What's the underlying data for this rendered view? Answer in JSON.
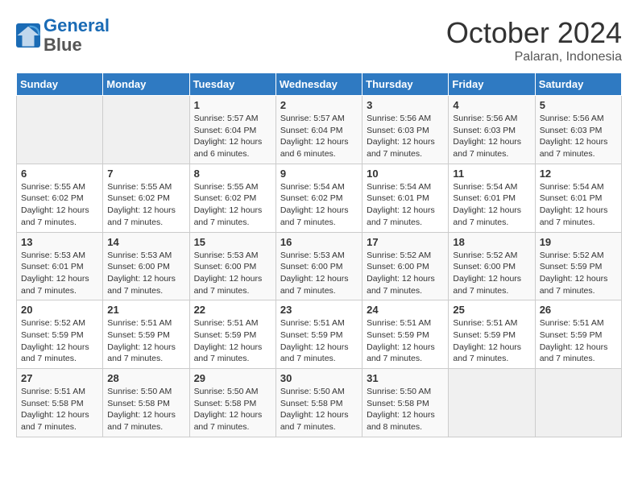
{
  "logo": {
    "line1": "General",
    "line2": "Blue"
  },
  "title": "October 2024",
  "location": "Palaran, Indonesia",
  "days_header": [
    "Sunday",
    "Monday",
    "Tuesday",
    "Wednesday",
    "Thursday",
    "Friday",
    "Saturday"
  ],
  "weeks": [
    [
      {
        "day": "",
        "info": ""
      },
      {
        "day": "",
        "info": ""
      },
      {
        "day": "1",
        "info": "Sunrise: 5:57 AM\nSunset: 6:04 PM\nDaylight: 12 hours\nand 6 minutes."
      },
      {
        "day": "2",
        "info": "Sunrise: 5:57 AM\nSunset: 6:04 PM\nDaylight: 12 hours\nand 6 minutes."
      },
      {
        "day": "3",
        "info": "Sunrise: 5:56 AM\nSunset: 6:03 PM\nDaylight: 12 hours\nand 7 minutes."
      },
      {
        "day": "4",
        "info": "Sunrise: 5:56 AM\nSunset: 6:03 PM\nDaylight: 12 hours\nand 7 minutes."
      },
      {
        "day": "5",
        "info": "Sunrise: 5:56 AM\nSunset: 6:03 PM\nDaylight: 12 hours\nand 7 minutes."
      }
    ],
    [
      {
        "day": "6",
        "info": "Sunrise: 5:55 AM\nSunset: 6:02 PM\nDaylight: 12 hours\nand 7 minutes."
      },
      {
        "day": "7",
        "info": "Sunrise: 5:55 AM\nSunset: 6:02 PM\nDaylight: 12 hours\nand 7 minutes."
      },
      {
        "day": "8",
        "info": "Sunrise: 5:55 AM\nSunset: 6:02 PM\nDaylight: 12 hours\nand 7 minutes."
      },
      {
        "day": "9",
        "info": "Sunrise: 5:54 AM\nSunset: 6:02 PM\nDaylight: 12 hours\nand 7 minutes."
      },
      {
        "day": "10",
        "info": "Sunrise: 5:54 AM\nSunset: 6:01 PM\nDaylight: 12 hours\nand 7 minutes."
      },
      {
        "day": "11",
        "info": "Sunrise: 5:54 AM\nSunset: 6:01 PM\nDaylight: 12 hours\nand 7 minutes."
      },
      {
        "day": "12",
        "info": "Sunrise: 5:54 AM\nSunset: 6:01 PM\nDaylight: 12 hours\nand 7 minutes."
      }
    ],
    [
      {
        "day": "13",
        "info": "Sunrise: 5:53 AM\nSunset: 6:01 PM\nDaylight: 12 hours\nand 7 minutes."
      },
      {
        "day": "14",
        "info": "Sunrise: 5:53 AM\nSunset: 6:00 PM\nDaylight: 12 hours\nand 7 minutes."
      },
      {
        "day": "15",
        "info": "Sunrise: 5:53 AM\nSunset: 6:00 PM\nDaylight: 12 hours\nand 7 minutes."
      },
      {
        "day": "16",
        "info": "Sunrise: 5:53 AM\nSunset: 6:00 PM\nDaylight: 12 hours\nand 7 minutes."
      },
      {
        "day": "17",
        "info": "Sunrise: 5:52 AM\nSunset: 6:00 PM\nDaylight: 12 hours\nand 7 minutes."
      },
      {
        "day": "18",
        "info": "Sunrise: 5:52 AM\nSunset: 6:00 PM\nDaylight: 12 hours\nand 7 minutes."
      },
      {
        "day": "19",
        "info": "Sunrise: 5:52 AM\nSunset: 5:59 PM\nDaylight: 12 hours\nand 7 minutes."
      }
    ],
    [
      {
        "day": "20",
        "info": "Sunrise: 5:52 AM\nSunset: 5:59 PM\nDaylight: 12 hours\nand 7 minutes."
      },
      {
        "day": "21",
        "info": "Sunrise: 5:51 AM\nSunset: 5:59 PM\nDaylight: 12 hours\nand 7 minutes."
      },
      {
        "day": "22",
        "info": "Sunrise: 5:51 AM\nSunset: 5:59 PM\nDaylight: 12 hours\nand 7 minutes."
      },
      {
        "day": "23",
        "info": "Sunrise: 5:51 AM\nSunset: 5:59 PM\nDaylight: 12 hours\nand 7 minutes."
      },
      {
        "day": "24",
        "info": "Sunrise: 5:51 AM\nSunset: 5:59 PM\nDaylight: 12 hours\nand 7 minutes."
      },
      {
        "day": "25",
        "info": "Sunrise: 5:51 AM\nSunset: 5:59 PM\nDaylight: 12 hours\nand 7 minutes."
      },
      {
        "day": "26",
        "info": "Sunrise: 5:51 AM\nSunset: 5:59 PM\nDaylight: 12 hours\nand 7 minutes."
      }
    ],
    [
      {
        "day": "27",
        "info": "Sunrise: 5:51 AM\nSunset: 5:58 PM\nDaylight: 12 hours\nand 7 minutes."
      },
      {
        "day": "28",
        "info": "Sunrise: 5:50 AM\nSunset: 5:58 PM\nDaylight: 12 hours\nand 7 minutes."
      },
      {
        "day": "29",
        "info": "Sunrise: 5:50 AM\nSunset: 5:58 PM\nDaylight: 12 hours\nand 7 minutes."
      },
      {
        "day": "30",
        "info": "Sunrise: 5:50 AM\nSunset: 5:58 PM\nDaylight: 12 hours\nand 7 minutes."
      },
      {
        "day": "31",
        "info": "Sunrise: 5:50 AM\nSunset: 5:58 PM\nDaylight: 12 hours\nand 8 minutes."
      },
      {
        "day": "",
        "info": ""
      },
      {
        "day": "",
        "info": ""
      }
    ]
  ]
}
